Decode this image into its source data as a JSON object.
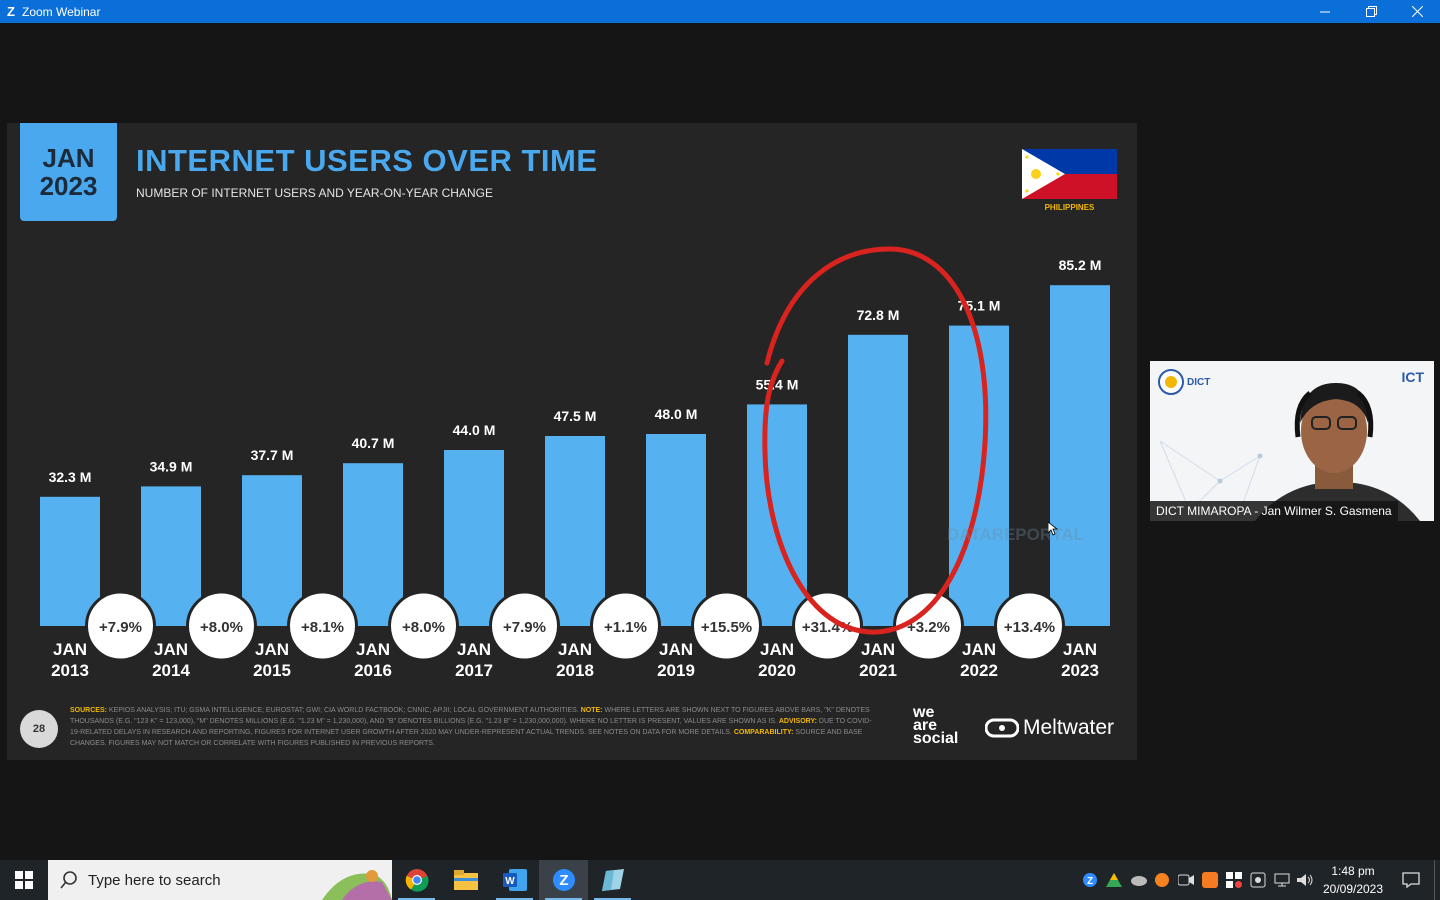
{
  "window": {
    "title": "Zoom Webinar",
    "minimize_icon": "minimize-icon",
    "maximize_icon": "restore-icon",
    "close_icon": "close-icon"
  },
  "slide": {
    "date_month": "JAN",
    "date_year": "2023",
    "title": "INTERNET USERS OVER TIME",
    "subtitle": "NUMBER OF INTERNET USERS AND YEAR-ON-YEAR CHANGE",
    "country": "PHILIPPINES",
    "page_number": "28",
    "watermark": "DATAREPORTAL",
    "sources_label": "SOURCES:",
    "sources_text": "KEPIOS ANALYSIS; ITU; GSMA INTELLIGENCE; EUROSTAT; GWI; CIA WORLD FACTBOOK; CNNIC; APJII; LOCAL GOVERNMENT AUTHORITIES.",
    "note_label": "NOTE:",
    "note_text": "WHERE LETTERS ARE SHOWN NEXT TO FIGURES ABOVE BARS, \"K\" DENOTES THOUSANDS (E.G. \"123 K\" = 123,000), \"M\" DENOTES MILLIONS (E.G. \"1.23 M\" = 1,230,000), AND \"B\" DENOTES BILLIONS (E.G. \"1.23 B\" = 1,230,000,000). WHERE NO LETTER IS PRESENT, VALUES ARE SHOWN AS IS.",
    "advisory_label": "ADVISORY:",
    "advisory_text": "DUE TO COVID-19-RELATED DELAYS IN RESEARCH AND REPORTING, FIGURES FOR INTERNET USER GROWTH AFTER 2020 MAY UNDER-REPRESENT ACTUAL TRENDS. SEE NOTES ON DATA FOR MORE DETAILS.",
    "comparability_label": "COMPARABILITY:",
    "comparability_text": "SOURCE AND BASE CHANGES. FIGURES MAY NOT MATCH OR CORRELATE WITH FIGURES PUBLISHED IN PREVIOUS REPORTS.",
    "logo_line1": "we",
    "logo_line2": "are",
    "logo_line3": "social",
    "logo_meltwater": "Meltwater"
  },
  "chart_data": {
    "type": "bar",
    "title": "INTERNET USERS OVER TIME",
    "subtitle": "NUMBER OF INTERNET USERS AND YEAR-ON-YEAR CHANGE",
    "categories": [
      "JAN 2013",
      "JAN 2014",
      "JAN 2015",
      "JAN 2016",
      "JAN 2017",
      "JAN 2018",
      "JAN 2019",
      "JAN 2020",
      "JAN 2021",
      "JAN 2022",
      "JAN 2023"
    ],
    "values": [
      32.3,
      34.9,
      37.7,
      40.7,
      44.0,
      47.5,
      48.0,
      55.4,
      72.8,
      75.1,
      85.2
    ],
    "value_labels": [
      "32.3 M",
      "34.9 M",
      "37.7 M",
      "40.7 M",
      "44.0 M",
      "47.5 M",
      "48.0 M",
      "55.4 M",
      "72.8 M",
      "75.1 M",
      "85.2 M"
    ],
    "yoy_changes": [
      "+7.9%",
      "+8.0%",
      "+8.1%",
      "+8.0%",
      "+7.9%",
      "+1.1%",
      "+15.5%",
      "+31.4%",
      "+3.2%",
      "+13.4%"
    ],
    "unit": "M",
    "bar_color": "#55b1f0",
    "annotation": "red hand-drawn ellipse around JAN 2020–JAN 2022"
  },
  "video": {
    "participant_name": "DICT MIMAROPA - Jan Wilmer S. Gasmena",
    "left_logo": "DICT",
    "right_logo": "ICT"
  },
  "taskbar": {
    "search_placeholder": "Type here to search",
    "time": "1:48 pm",
    "date": "20/09/2023",
    "apps": [
      "chrome-icon",
      "file-explorer-icon",
      "word-icon",
      "zoom-icon",
      "notes-icon"
    ]
  }
}
